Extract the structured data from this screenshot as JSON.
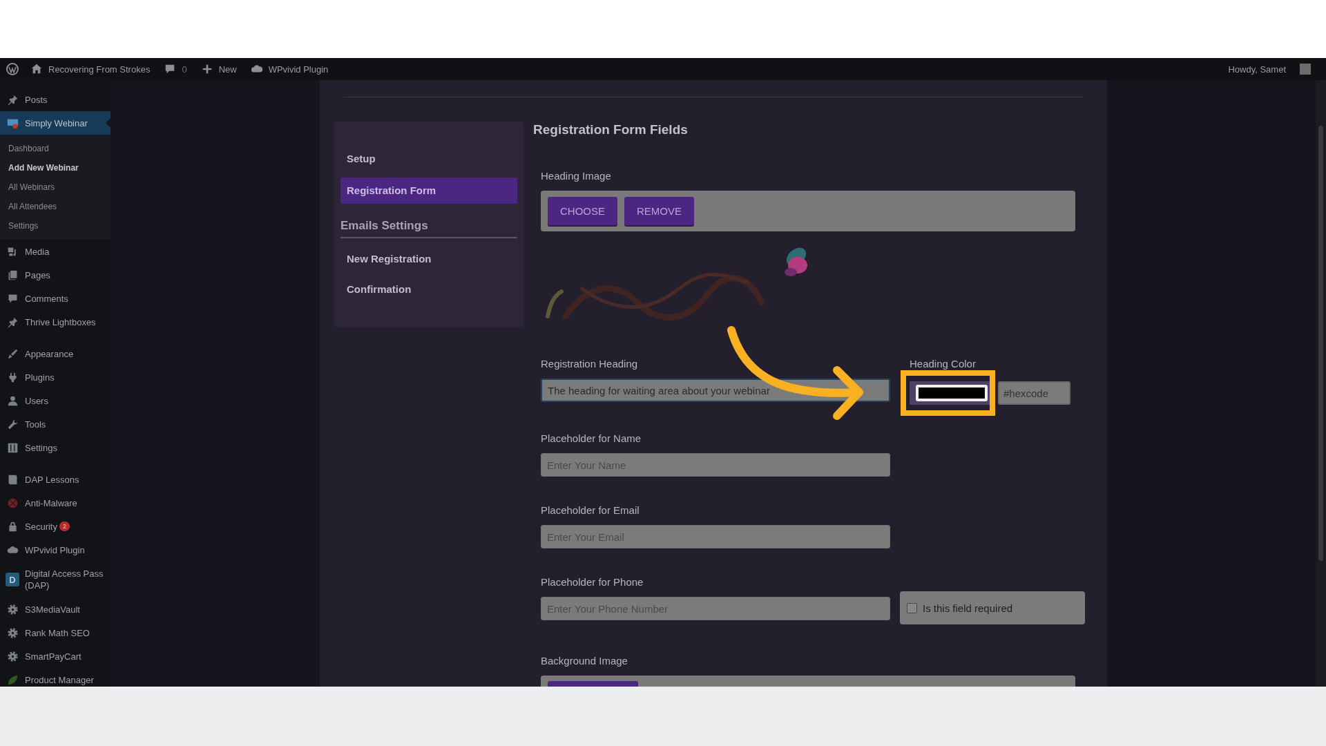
{
  "admin_bar": {
    "site_name": "Recovering From Strokes",
    "comments_count": "0",
    "new_label": "New",
    "plugin_label": "WPvivid Plugin",
    "greeting": "Howdy, Samet"
  },
  "sidebar": {
    "groups": [
      [
        {
          "label": "Posts",
          "selected": false
        },
        {
          "label": "Simply Webinar",
          "selected": true,
          "children": [
            {
              "label": "Dashboard",
              "selected": false
            },
            {
              "label": "Add New Webinar",
              "selected": true
            },
            {
              "label": "All Webinars",
              "selected": false
            },
            {
              "label": "All Attendees",
              "selected": false
            },
            {
              "label": "Settings",
              "selected": false
            }
          ]
        },
        {
          "label": "Media",
          "selected": false
        },
        {
          "label": "Pages",
          "selected": false
        },
        {
          "label": "Comments",
          "selected": false
        },
        {
          "label": "Thrive Lightboxes",
          "selected": false
        }
      ],
      [
        {
          "label": "Appearance",
          "selected": false
        },
        {
          "label": "Plugins",
          "selected": false
        },
        {
          "label": "Users",
          "selected": false
        },
        {
          "label": "Tools",
          "selected": false
        },
        {
          "label": "Settings",
          "selected": false
        }
      ],
      [
        {
          "label": "DAP Lessons",
          "selected": false
        },
        {
          "label": "Anti-Malware",
          "selected": false
        },
        {
          "label": "Security",
          "selected": false,
          "badge": "2"
        },
        {
          "label": "WPvivid Plugin",
          "selected": false
        },
        {
          "label": "Digital Access Pass (DAP)",
          "selected": false,
          "icon_text": "D"
        },
        {
          "label": "S3MediaVault",
          "selected": false
        },
        {
          "label": "Rank Math SEO",
          "selected": false
        },
        {
          "label": "SmartPayCart",
          "selected": false
        },
        {
          "label": "Product Manager",
          "selected": false
        }
      ]
    ]
  },
  "settings_nav": [
    {
      "kind": "link",
      "label": "Setup",
      "selected": false
    },
    {
      "kind": "link",
      "label": "Registration Form",
      "selected": true
    },
    {
      "kind": "heading",
      "label": "Emails Settings"
    },
    {
      "kind": "link",
      "label": "New Registration",
      "selected": false
    },
    {
      "kind": "link",
      "label": "Confirmation",
      "selected": false
    }
  ],
  "form": {
    "title": "Registration Form Fields",
    "heading_image": {
      "label": "Heading Image",
      "buttons": [
        "CHOOSE",
        "REMOVE"
      ],
      "preview": {
        "kind": "picture"
      }
    },
    "registration_heading": {
      "label": "Registration Heading",
      "value": "The heading for waiting area about your webinar",
      "color_label": "Heading Color",
      "color_placeholder": "#hexcode"
    },
    "fields": [
      {
        "label": "Placeholder for Name",
        "placeholder": "Enter Your Name"
      },
      {
        "label": "Placeholder for Email",
        "placeholder": "Enter Your Email"
      },
      {
        "label": "Placeholder for Phone",
        "placeholder": "Enter Your Phone Number",
        "required": {
          "label": "Is this field required",
          "checked": false
        }
      }
    ],
    "background_image": {
      "label": "Background Image"
    }
  }
}
